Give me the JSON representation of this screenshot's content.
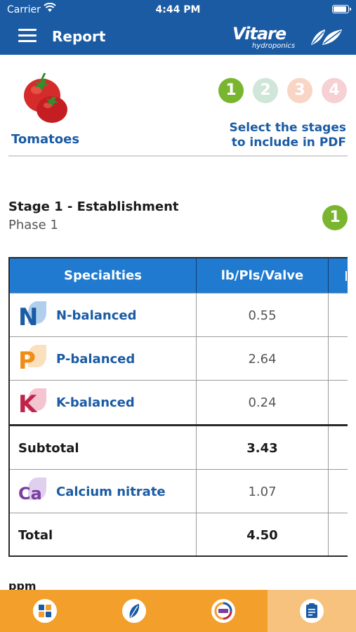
{
  "status_bar": {
    "carrier": "Carrier",
    "time": "4:44 PM"
  },
  "nav": {
    "title": "Report",
    "brand": "Vitare",
    "brand_sub": "hydroponics"
  },
  "crop": {
    "name": "Tomatoes",
    "icon": "tomato-icon"
  },
  "stages": {
    "items": [
      {
        "label": "1",
        "color": "#79b52f"
      },
      {
        "label": "2",
        "color": "#cfe6d9"
      },
      {
        "label": "3",
        "color": "#f9d5c6"
      },
      {
        "label": "4",
        "color": "#f6d0d3"
      }
    ],
    "hint_line1": "Select the stages",
    "hint_line2": "to include in PDF"
  },
  "stage_section": {
    "title": "Stage 1 - Establishment",
    "subtitle": "Phase 1",
    "badge": "1"
  },
  "table": {
    "headers": [
      "Specialties",
      "lb/Pls/Valve"
    ],
    "rows": [
      {
        "name": "N-balanced",
        "letter": "N",
        "color": "#1a5ba4",
        "leaf": "#5fa0dc",
        "value": "0.55"
      },
      {
        "name": "P-balanced",
        "letter": "P",
        "color": "#ef8d17",
        "leaf": "#f7c27d",
        "value": "2.64"
      },
      {
        "name": "K-balanced",
        "letter": "K",
        "color": "#c0244b",
        "leaf": "#e98aa3",
        "value": "0.24"
      }
    ],
    "subtotal": {
      "label": "Subtotal",
      "value": "3.43"
    },
    "calcium": {
      "name": "Calcium nitrate",
      "letter": "Ca",
      "color": "#7b3ea3",
      "leaf": "#c4a2dc",
      "value": "1.07"
    },
    "total": {
      "label": "Total",
      "value": "4.50"
    }
  },
  "ppm_label": "ppm",
  "tabs": [
    {
      "name": "dashboard-icon",
      "active": false
    },
    {
      "name": "leaf-icon",
      "active": false
    },
    {
      "name": "ppm-icon",
      "active": false
    },
    {
      "name": "report-icon",
      "active": true
    }
  ]
}
